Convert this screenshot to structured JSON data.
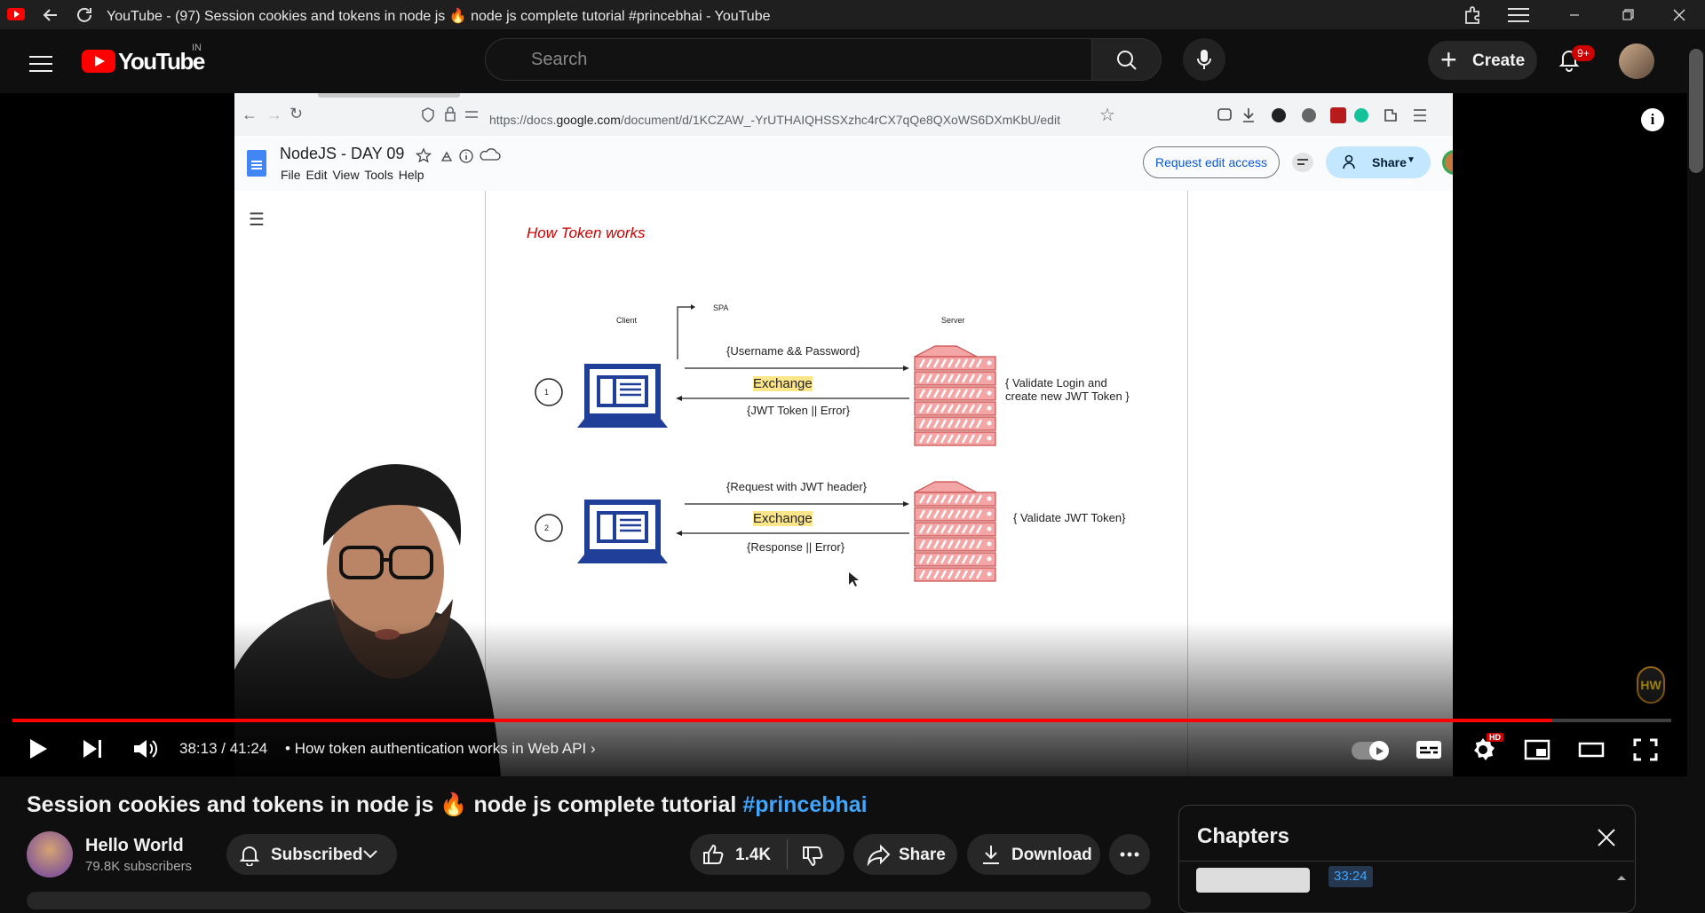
{
  "window": {
    "title": "YouTube - (97) Session cookies and tokens in node js 🔥 node js complete tutorial #princebhai - YouTube"
  },
  "masthead": {
    "logo_text": "YouTube",
    "country_code": "IN",
    "search_placeholder": "Search",
    "create_label": "Create",
    "notification_count": "9+"
  },
  "video_frame": {
    "url_prefix": "https://docs.",
    "url_domain": "google.com",
    "url_rest": "/document/d/1KCZAW_-YrUTHAIQHSSXzhc4rCX7qQe8QXoWS6DXmKbU/edit",
    "doc_title": "NodeJS - DAY 09",
    "doc_menu": "File   Edit   View   Tools   Help",
    "request_edit_label": "Request edit access",
    "share_label": "Share",
    "diagram": {
      "title": "How Token works",
      "client_label": "Client",
      "server_label": "Server",
      "spa_label": "SPA",
      "step1_num": "1",
      "step1_request": "{Username && Password}",
      "step1_exchange": "Exchange",
      "step1_response": "{JWT Token || Error}",
      "step1_server_note_line1": "{ Validate Login and",
      "step1_server_note_line2": "create new JWT Token }",
      "step2_num": "2",
      "step2_request": "{Request with JWT header}",
      "step2_exchange": "Exchange",
      "step2_response": "{Response || Error}",
      "step2_server_note": "{ Validate JWT Token}"
    },
    "watermark": "HW"
  },
  "player": {
    "progress_fraction": 0.928,
    "time": "38:13 / 41:24",
    "chapter_separator": "•",
    "chapter_title": "How token authentication works in Web API",
    "hd_badge": "HD"
  },
  "video_info": {
    "title_main": "Session cookies and tokens in node js 🔥 node js complete tutorial ",
    "title_hashtag": "#princebhai",
    "channel_name": "Hello World",
    "subscribers": "79.8K subscribers",
    "subscribe_label": "Subscribed",
    "like_count": "1.4K",
    "share_label": "Share",
    "download_label": "Download"
  },
  "chapters_panel": {
    "title": "Chapters",
    "first_time": "33:24"
  }
}
